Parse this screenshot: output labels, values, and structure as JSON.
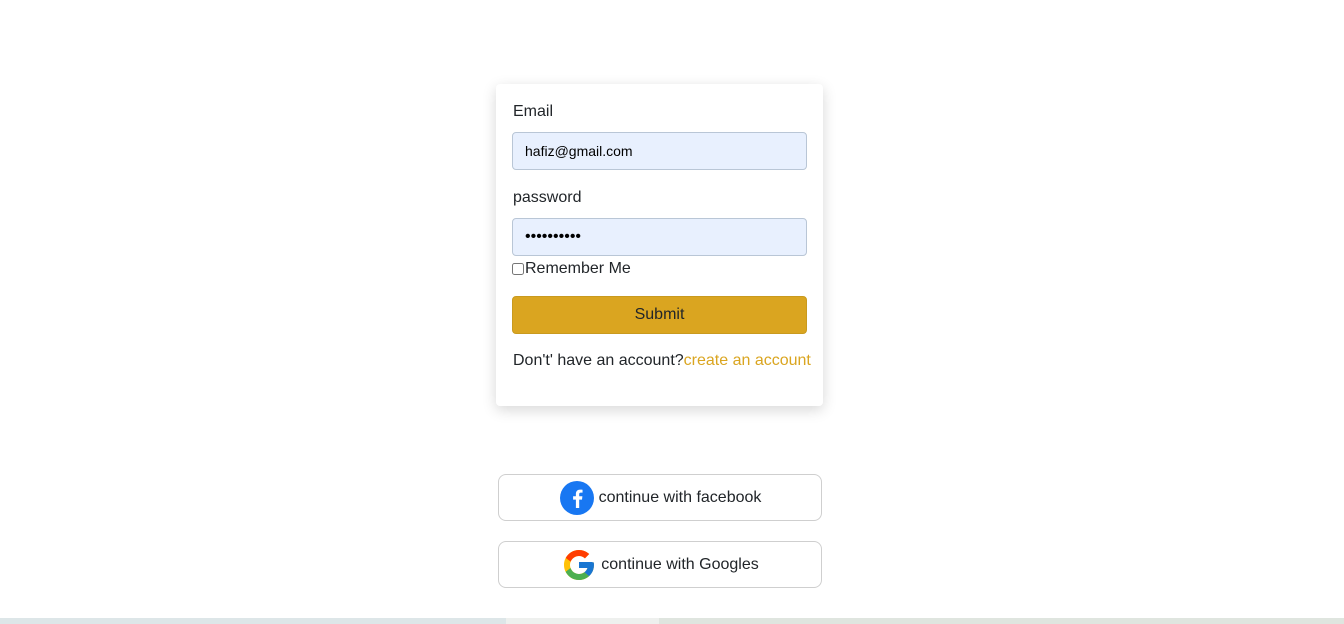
{
  "login_form": {
    "email_label": "Email",
    "email_value": "hafiz@gmail.com",
    "password_label": "password",
    "password_value": "••••••••••",
    "remember_label": "Remember Me",
    "submit_label": "Submit",
    "signup_prompt": "Don't' have an account?",
    "signup_link": "create an account"
  },
  "social": {
    "facebook_label": "continue with facebook",
    "google_label": "continue with Googles"
  },
  "colors": {
    "accent": "#daa520",
    "input_bg": "#e8f0fe",
    "facebook": "#1877f2"
  }
}
